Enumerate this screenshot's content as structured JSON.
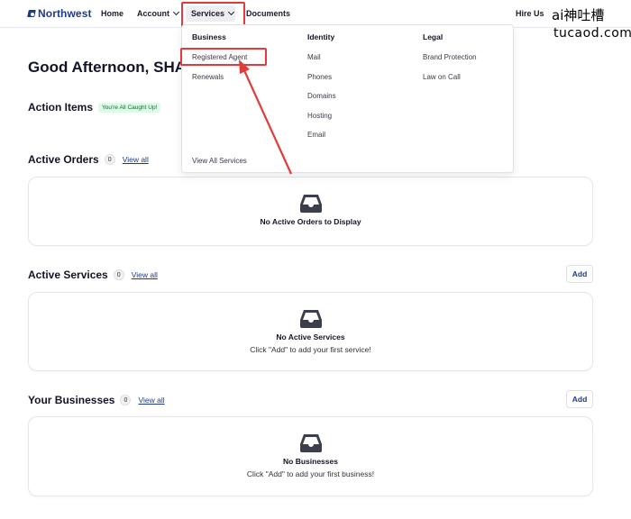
{
  "nav": {
    "logo": "Northwest",
    "home": "Home",
    "account": "Account",
    "services": "Services",
    "documents": "Documents",
    "hire_us": "Hire Us"
  },
  "watermark": {
    "line1": "ai神吐槽",
    "line2": "tucaod.com"
  },
  "greeting": "Good Afternoon, SHA",
  "dropdown": {
    "columns": [
      {
        "heading": "Business",
        "items": [
          "Registered Agent",
          "Renewals"
        ]
      },
      {
        "heading": "Identity",
        "items": [
          "Mail",
          "Phones",
          "Domains",
          "Hosting",
          "Email"
        ]
      },
      {
        "heading": "Legal",
        "items": [
          "Brand Protection",
          "Law on Call"
        ]
      }
    ],
    "view_all": "View All Services"
  },
  "action_items": {
    "title": "Action Items",
    "badge": "You're All Caught Up!"
  },
  "active_orders": {
    "title": "Active Orders",
    "count": "0",
    "view_all": "View all",
    "empty_title": "No Active Orders to Display"
  },
  "active_services": {
    "title": "Active Services",
    "count": "0",
    "view_all": "View all",
    "add": "Add",
    "empty_title": "No Active Services",
    "empty_sub": "Click \"Add\" to add your first service!"
  },
  "your_businesses": {
    "title": "Your Businesses",
    "count": "0",
    "view_all": "View all",
    "add": "Add",
    "empty_title": "No Businesses",
    "empty_sub": "Click \"Add\" to add your first business!"
  },
  "colors": {
    "brand": "#1e3a8a",
    "annotation_red": "#e23b3b",
    "success_bg": "#dcfce7",
    "success_text": "#166534"
  }
}
